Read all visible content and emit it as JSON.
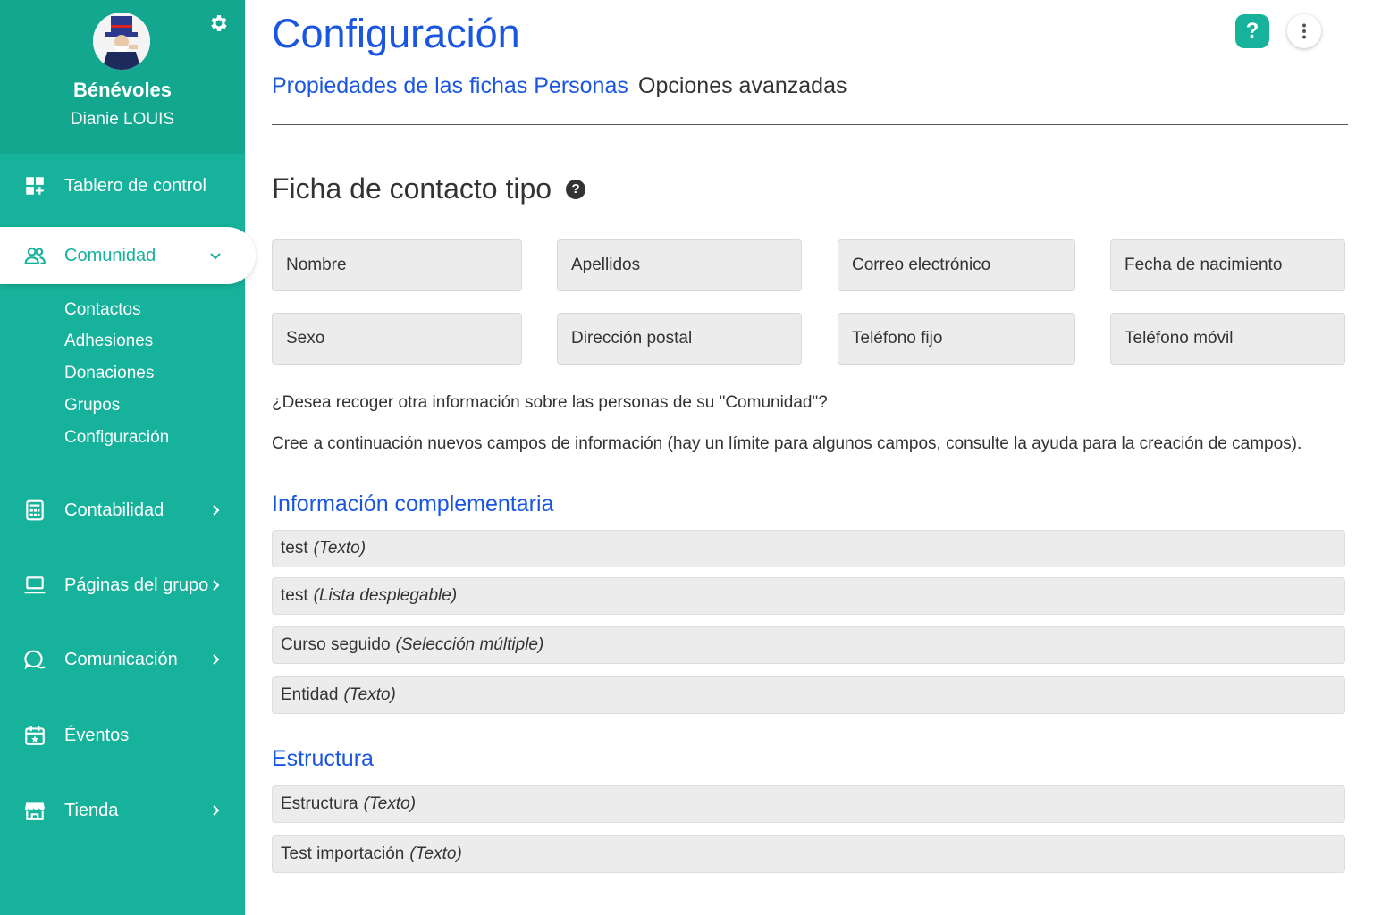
{
  "sidebar": {
    "org_name": "Bénévoles",
    "user_name": "Dianie LOUIS",
    "nav": [
      {
        "label": "Tablero de control",
        "icon": "dashboard-icon"
      },
      {
        "label": "Comunidad",
        "icon": "people-icon"
      },
      {
        "label": "Contabilidad",
        "icon": "calculator-icon"
      },
      {
        "label": "Páginas del grupo",
        "icon": "laptop-icon"
      },
      {
        "label": "Comunicación",
        "icon": "chat-icon"
      },
      {
        "label": "Éventos",
        "icon": "calendar-icon"
      },
      {
        "label": "Tienda",
        "icon": "store-icon"
      }
    ],
    "sub_items": [
      "Contactos",
      "Adhesiones",
      "Donaciones",
      "Grupos",
      "Configuración"
    ]
  },
  "header": {
    "title": "Configuración",
    "help_label": "?"
  },
  "tabs": [
    "Propiedades de las fichas Personas",
    "Opciones avanzadas"
  ],
  "contact_card": {
    "title": "Ficha de contacto tipo",
    "fields": [
      "Nombre",
      "Apellidos",
      "Correo electrónico",
      "Fecha de nacimiento",
      "Sexo",
      "Dirección postal",
      "Teléfono fijo",
      "Teléfono móvil"
    ]
  },
  "intro": {
    "question": "¿Desea recoger otra información sobre las personas de su \"Comunidad\"?",
    "instruction": "Cree a continuación nuevos campos de información (hay un límite para algunos campos, consulte la ayuda para la creación de campos)."
  },
  "sections": [
    {
      "title": "Información complementaria",
      "rows": [
        {
          "name": "test",
          "type": "(Texto)"
        },
        {
          "name": "test",
          "type": "(Lista desplegable)"
        },
        {
          "name": "Curso seguido",
          "type": "(Selección múltiple)"
        },
        {
          "name": "Entidad",
          "type": "(Texto)"
        }
      ]
    },
    {
      "title": "Estructura",
      "rows": [
        {
          "name": "Estructura",
          "type": "(Texto)"
        },
        {
          "name": "Test importación",
          "type": "(Texto)"
        }
      ]
    }
  ],
  "colors": {
    "accent": "#16b29b",
    "link": "#1a56e0"
  }
}
